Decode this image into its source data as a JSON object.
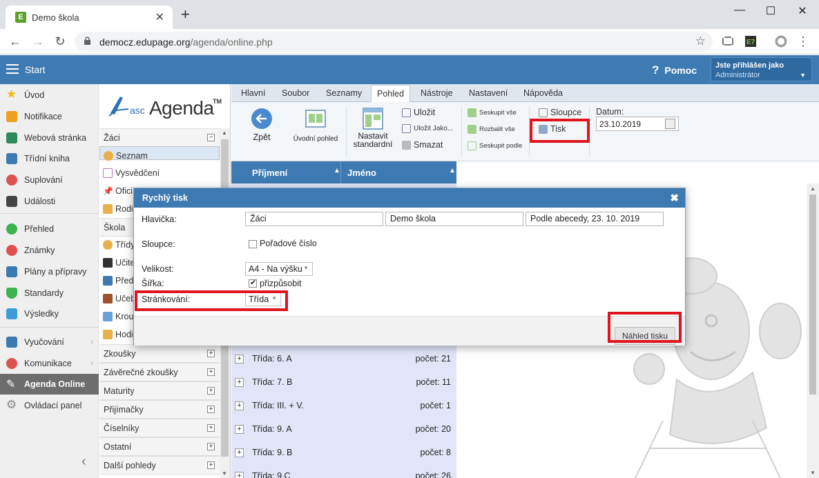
{
  "browser": {
    "tab_title": "Demo škola",
    "favicon_letter": "E",
    "url_host": "democz.edupage.org",
    "url_path": "/agenda/online.php"
  },
  "appbar": {
    "start_label": "Start",
    "help_label": "Pomoc",
    "user_line1": "Jste přihlášen jako",
    "user_line2": "Administrátor"
  },
  "left_menu": {
    "items": [
      {
        "label": "Úvod",
        "icon": "star-icon",
        "color": "#f2b90f"
      },
      {
        "label": "Notifikace",
        "icon": "envelope-icon",
        "color": "#f0a020"
      },
      {
        "label": "Webová stránka",
        "icon": "home-icon",
        "color": "#2e8a5a"
      },
      {
        "label": "Třídní kniha",
        "icon": "book-icon",
        "color": "#3d7ab1"
      },
      {
        "label": "Suplování",
        "icon": "person-icon",
        "color": "#d9534f"
      },
      {
        "label": "Události",
        "icon": "calendar-icon",
        "color": "#444444"
      },
      {
        "label": "Přehled",
        "icon": "check-icon",
        "color": "#3bb34a"
      },
      {
        "label": "Známky",
        "icon": "grades-icon",
        "color": "#e05050"
      },
      {
        "label": "Plány a přípravy",
        "icon": "briefcase-icon",
        "color": "#3d7ab1"
      },
      {
        "label": "Standardy",
        "icon": "shield-icon",
        "color": "#3bb34a"
      },
      {
        "label": "Výsledky",
        "icon": "bar-chart-icon",
        "color": "#3d9bd6"
      },
      {
        "label": "Vyučování",
        "icon": "book-open-icon",
        "color": "#3d7ab1"
      },
      {
        "label": "Komunikace",
        "icon": "chat-icon",
        "color": "#d9534f"
      },
      {
        "label": "Agenda Online",
        "icon": "pencil-icon",
        "color": "#ffffff"
      },
      {
        "label": "Ovládací panel",
        "icon": "gear-icon",
        "color": "#888888"
      }
    ]
  },
  "agenda_panel": {
    "logo_asc": "asc",
    "logo_agenda": "Agenda",
    "logo_tm": "TM",
    "section_zaci": "Žáci",
    "zaci_items": [
      "Seznam",
      "Vysvědčení",
      "Ofici",
      "Rodi"
    ],
    "section_skola": "Škola",
    "skola_items": [
      "Třídy",
      "Učite",
      "Před",
      "Učeb",
      "Krou",
      "Hodi"
    ],
    "sections": [
      "Zkoušky",
      "Závěrečné zkoušky",
      "Maturity",
      "Přijímačky",
      "Číselníky",
      "Ostatní",
      "Další pohledy"
    ]
  },
  "ribbon": {
    "tabs": [
      "Hlavní",
      "Soubor",
      "Seznamy",
      "Pohled",
      "Nástroje",
      "Nastavení",
      "Nápověda"
    ],
    "active_tab": "Pohled",
    "zpet": "Zpět",
    "uvodni_pohled": "Úvodní pohled",
    "nastavit_l1": "Nastavit",
    "nastavit_l2": "standardní",
    "ulozit": "Uložit",
    "ulozit_jako": "Uložit Jako...",
    "smazat": "Smazat",
    "seskupit_vse": "Seskupit vše",
    "rozbalit_vse": "Rozbalit vše",
    "seskupit_podle": "Seskupit podle",
    "sloupce": "Sloupce",
    "tisk": "Tisk",
    "datum_label": "Datum:",
    "datum_value": "23.10.2019"
  },
  "table": {
    "col1": "Příjmení",
    "col2": "Jméno",
    "groups": [
      {
        "name": "Třída: 6. A",
        "count": "počet: 21"
      },
      {
        "name": "Třída: 7. B",
        "count": "počet: 11"
      },
      {
        "name": "Třída: III. + V.",
        "count": "počet: 1"
      },
      {
        "name": "Třída: 9. A",
        "count": "počet: 20"
      },
      {
        "name": "Třída: 9. B",
        "count": "počet: 8"
      },
      {
        "name": "Třída: 9.C",
        "count": "počet: 26"
      }
    ]
  },
  "dialog": {
    "title": "Rychlý tisk",
    "hlavicka_label": "Hlavička:",
    "hlavicka_1": "Žáci",
    "hlavicka_2": "Demo škola",
    "hlavicka_3": "Podle abecedy, 23. 10. 2019",
    "sloupce_label": "Sloupce:",
    "poradove_cislo": "Pořadové číslo",
    "velikost_label": "Velikost:",
    "velikost_value": "A4 - Na výšku",
    "sirka_label": "Šířka:",
    "prizpusobit": "přizpůsobit",
    "strankovani_label": "Stránkování:",
    "strankovani_value": "Třída",
    "preview_button": "Náhled tisku"
  },
  "colors": {
    "accent_blue": "#3d7ab1",
    "highlight_red": "#e0141e"
  }
}
